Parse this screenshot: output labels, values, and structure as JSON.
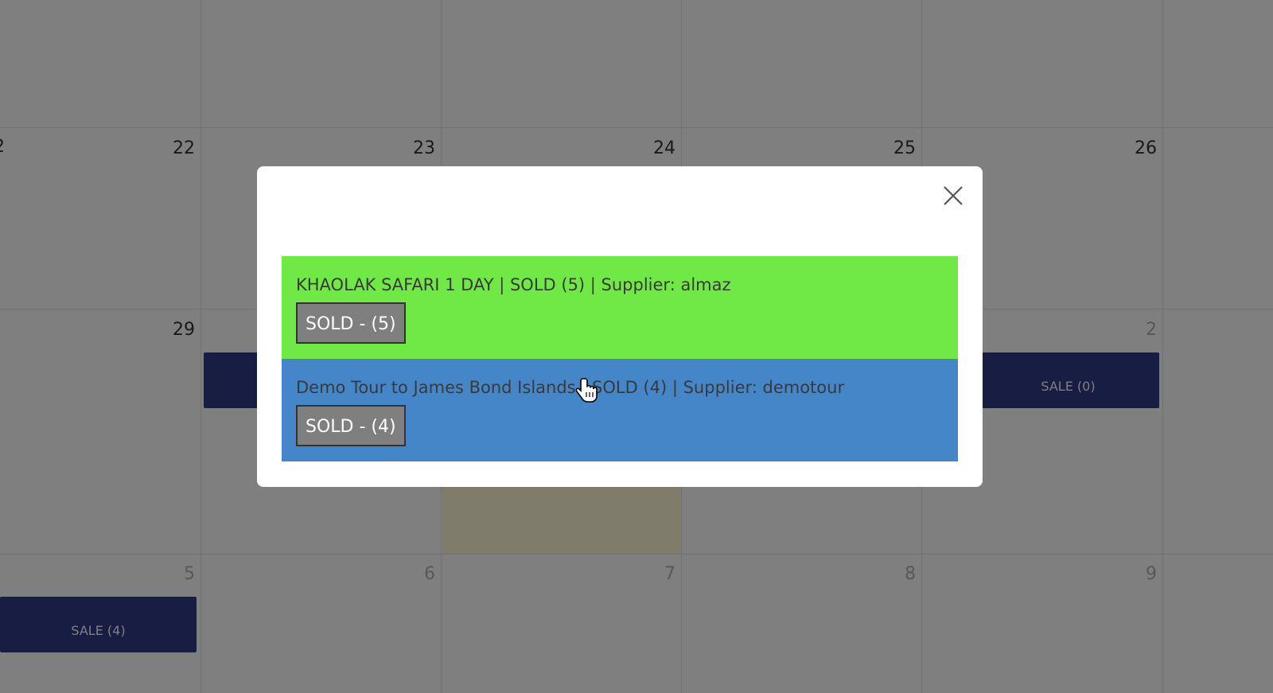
{
  "calendar": {
    "week1": {
      "days": [
        "22",
        "23",
        "24",
        "25",
        "26"
      ],
      "left_partial": "2"
    },
    "week2": {
      "days": [
        "29",
        "",
        "",
        "",
        "2"
      ]
    },
    "week3": {
      "days": [
        "5",
        "6",
        "7",
        "8",
        "9"
      ]
    },
    "events": {
      "sale_0": "SALE (0)",
      "sale_4": "SALE (4)"
    },
    "colors": {
      "event": "#2e3a87",
      "today_highlight": "#fff8d6"
    }
  },
  "modal": {
    "bookings": [
      {
        "title": "KHAOLAK SAFARI 1 DAY | SOLD (5) | Supplier: almaz",
        "button": "SOLD - (5)",
        "color": "#70e846"
      },
      {
        "title": "Demo Tour to James Bond Islands | SOLD (4) | Supplier: demotour",
        "button": "SOLD - (4)",
        "color": "#4486c8"
      }
    ],
    "close_icon": "close-icon"
  }
}
